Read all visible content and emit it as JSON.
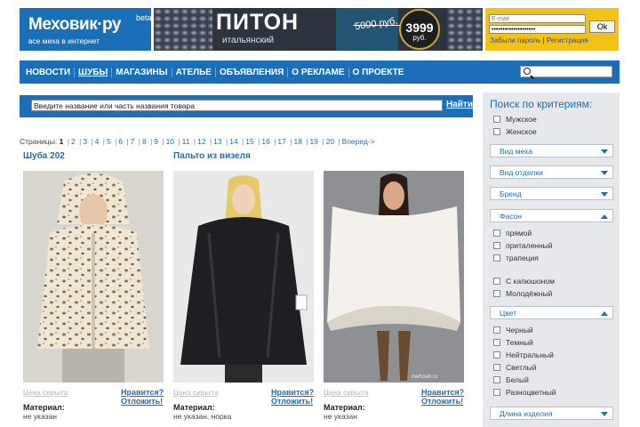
{
  "header": {
    "logo_name": "Меховик·ру",
    "logo_beta": "beta",
    "logo_tagline": "все меха в интернет",
    "banner": {
      "title": "ПИТОН",
      "subtitle": "итальянский",
      "old_price": "5000 руб.",
      "price": "3999",
      "currency": "руб."
    },
    "login": {
      "email_placeholder": "E-mail",
      "password_value": "••••••••••••••••••••",
      "ok_label": "Ok",
      "forgot_link": "Забыли пароль",
      "link_sep": " | ",
      "register_link": "Регистрация"
    }
  },
  "nav": {
    "items": [
      "НОВОСТИ",
      "ШУБЫ",
      "МАГАЗИНЫ",
      "АТЕЛЬЕ",
      "ОБЪЯВЛЕНИЯ",
      "О РЕКЛАМЕ",
      "О ПРОЕКТЕ"
    ],
    "active": "ШУБЫ"
  },
  "search": {
    "placeholder": "Введите название или часть названия товара",
    "button": "Найти"
  },
  "pager": {
    "label": "Страницы:",
    "current": "1",
    "pages": [
      "2",
      "3",
      "4",
      "5",
      "6",
      "7",
      "8",
      "9",
      "10",
      "11",
      "12",
      "13",
      "14",
      "15",
      "16",
      "17",
      "18",
      "19",
      "20"
    ],
    "next": "Вперед->"
  },
  "products": [
    {
      "title": "Шуба 202",
      "price": "Цена скрыта",
      "like": "Нравится?",
      "postpone": "Отложить!",
      "material_label": "Материал:",
      "material": "не указан"
    },
    {
      "title": "Пальто из визеля",
      "price": "Цена скрыта",
      "like": "Нравится?",
      "postpone": "Отложить!",
      "material_label": "Материал:",
      "material": "не указан, норка"
    },
    {
      "title": "",
      "price": "Цена скрыта",
      "like": "Нравится?",
      "postpone": "Отложить!",
      "material_label": "Материал:",
      "material": "не указан",
      "watermark": "mehovik.ru"
    }
  ],
  "sidebar": {
    "heading": "Поиск по критериям:",
    "gender": [
      "Мужское",
      "Женское"
    ],
    "dropdowns": {
      "fur": "Вид меха",
      "trim": "Вид отделки",
      "brand": "Бренд",
      "style": "Фасон",
      "color": "Цвет",
      "length": "Длина изделия"
    },
    "style_options": [
      "прямой",
      "приталенный",
      "трапеция",
      "С капюшоном",
      "Молодёжный"
    ],
    "color_options": [
      "Черный",
      "Темный",
      "Нейтральный",
      "Светлый",
      "Белый",
      "Разноцветный"
    ]
  },
  "colors": {
    "brand_blue": "#1a6fb8",
    "login_yellow": "#f2c21b",
    "sidebar_bg": "#e6e8ec"
  }
}
